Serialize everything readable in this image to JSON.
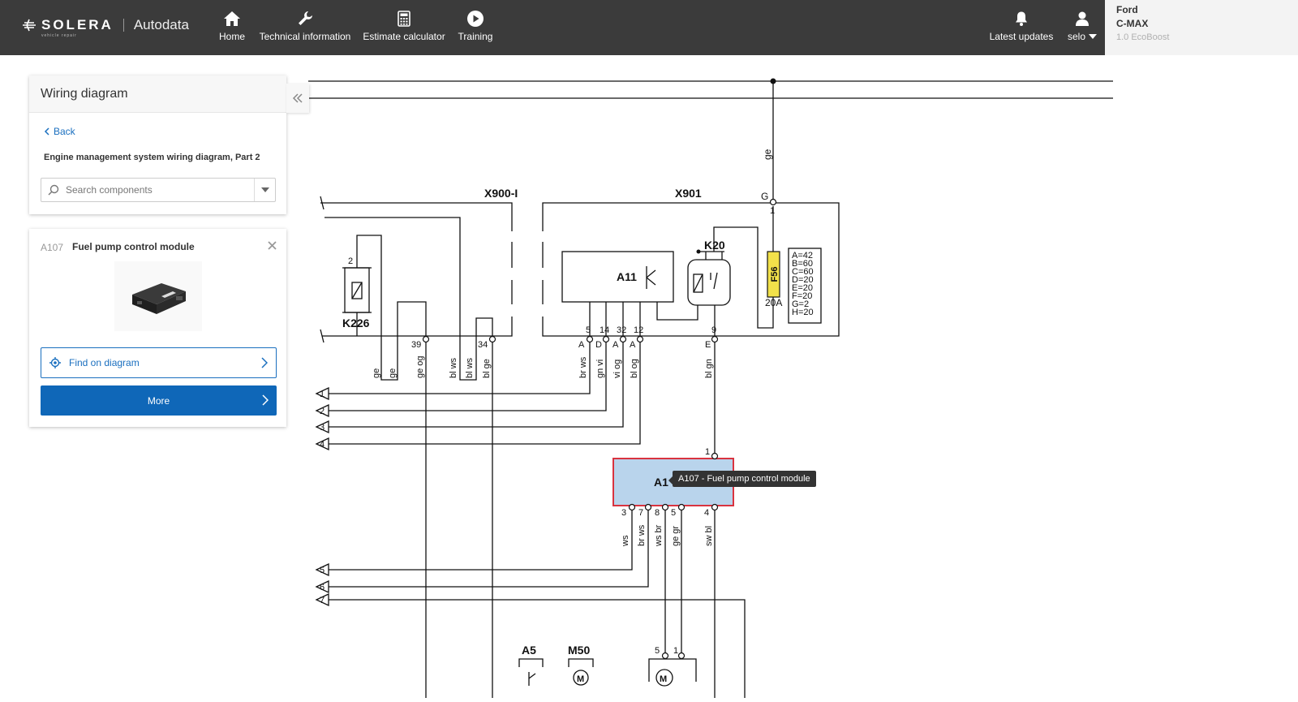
{
  "brand": {
    "company": "SOLERA",
    "company_sub": "vehicle repair",
    "product": "Autodata"
  },
  "nav": {
    "home": "Home",
    "technical": "Technical information",
    "estimate": "Estimate calculator",
    "training": "Training",
    "updates": "Latest updates",
    "user": "selo"
  },
  "vehicle": {
    "make": "Ford",
    "model": "C-MAX",
    "engine": "1.0 EcoBoost"
  },
  "panel": {
    "title": "Wiring diagram",
    "back": "Back",
    "diagram_name": "Engine management system wiring diagram, Part 2",
    "search_placeholder": "Search components"
  },
  "component": {
    "code": "A107",
    "name": "Fuel pump control module",
    "find_label": "Find on diagram",
    "more_label": "More"
  },
  "tooltip": "A107 - Fuel pump control module",
  "diagram": {
    "connectors": {
      "x900": "X900-I",
      "x901": "X901"
    },
    "components": {
      "k226": "K226",
      "k20": "K20",
      "a11": "A11",
      "a107": "A1",
      "a5": "A5",
      "m50": "M50",
      "m": "M",
      "f56": "F56",
      "amp": "20A"
    },
    "fuse_table": [
      "A=42",
      "B=60",
      "C=60",
      "D=20",
      "E=20",
      "F=20",
      "G=2",
      "H=20"
    ],
    "wire_top": "ge",
    "pin_g": "G",
    "pins_x900": [
      "39",
      "34"
    ],
    "pins_x901": [
      "5",
      "14",
      "32",
      "12",
      "9",
      "1"
    ],
    "pin_letters_x901": [
      "A",
      "D",
      "A",
      "A",
      "E"
    ],
    "pin_k226": "2",
    "wires_x900": [
      "ge",
      "ge",
      "ge og",
      "bl ws",
      "bl ws",
      "bl ge"
    ],
    "wires_x901": [
      "br ws",
      "gn vi",
      "vi og",
      "bl og",
      "bl gn"
    ],
    "a107_pins_top": "1",
    "a107_pins_bottom": [
      "3",
      "7",
      "8",
      "5",
      "4"
    ],
    "wires_a107": [
      "ws",
      "br ws",
      "ws br",
      "ge gr",
      "sw bl"
    ],
    "m_pins": [
      "5",
      "1"
    ],
    "refs": [
      "1",
      "2",
      "3",
      "4",
      "5",
      "6",
      "7"
    ]
  },
  "colors": {
    "topbar": "#3b3b3b",
    "accent": "#0f67b8",
    "highlight_fill": "#b9d4ec",
    "highlight_border": "#d9333f",
    "fuse": "#f2e14a"
  }
}
